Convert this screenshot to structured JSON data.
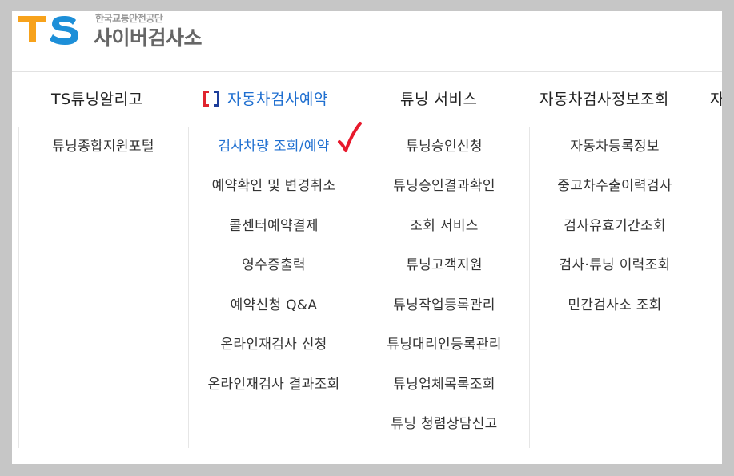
{
  "header": {
    "logo_mark": "TS",
    "org_name": "한국교통안전공단",
    "site_title": "사이버검사소",
    "colors": {
      "mark_orange": "#f7a21b",
      "mark_blue": "#1d8fd8"
    }
  },
  "nav": {
    "items": [
      {
        "label": "TS튜닝알리고",
        "active": false
      },
      {
        "label": "자동차검사예약",
        "active": true,
        "icon": "brackets-logo-icon"
      },
      {
        "label": "튜닝 서비스",
        "active": false
      },
      {
        "label": "자동차검사정보조회",
        "active": false
      },
      {
        "label": "자동",
        "active": false
      }
    ],
    "active_color": "#1f6fd0"
  },
  "columns": [
    {
      "items": [
        "튜닝종합지원포털"
      ]
    },
    {
      "items": [
        "검사차량 조회/예약",
        "예약확인 및 변경취소",
        "콜센터예약결제",
        "영수증출력",
        "예약신청 Q&A",
        "온라인재검사 신청",
        "온라인재검사 결과조회"
      ],
      "active_index": 0
    },
    {
      "items": [
        "튜닝승인신청",
        "튜닝승인결과확인",
        "조회 서비스",
        "튜닝고객지원",
        "튜닝작업등록관리",
        "튜닝대리인등록관리",
        "튜닝업체목록조회",
        "튜닝 청렴상담신고"
      ]
    },
    {
      "items": [
        "자동차등록정보",
        "중고차수출이력검사",
        "검사유효기간조회",
        "검사·튜닝 이력조회",
        "민간검사소 조회"
      ]
    }
  ],
  "annotation": {
    "icon": "red-checkmark-icon",
    "color": "#e8192c"
  }
}
